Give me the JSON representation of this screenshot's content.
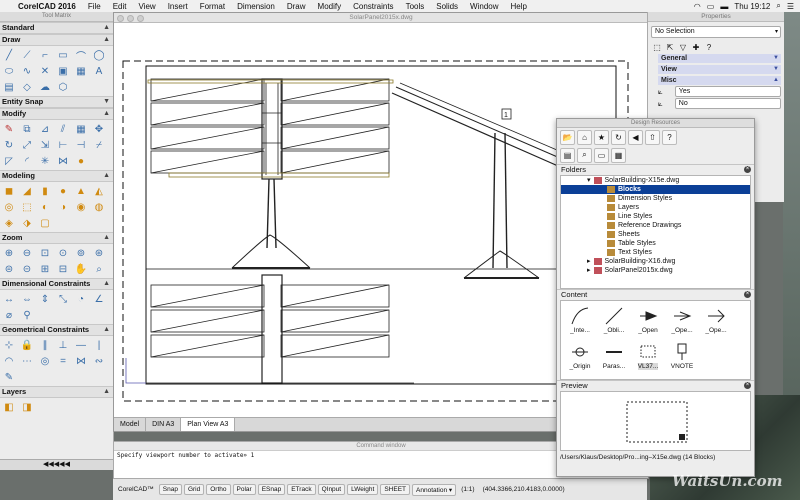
{
  "menubar": {
    "apple": "",
    "app_name": "CorelCAD 2016",
    "items": [
      "File",
      "Edit",
      "View",
      "Insert",
      "Format",
      "Dimension",
      "Draw",
      "Modify",
      "Constraints",
      "Tools",
      "Solids",
      "Window",
      "Help"
    ],
    "clock": "Thu 19:12"
  },
  "tool_matrix": {
    "title": "Tool Matrix",
    "sections": [
      "Standard",
      "Draw",
      "Entity Snap",
      "Modify",
      "Modeling",
      "Zoom",
      "Dimensional Constraints",
      "Geometrical Constraints",
      "Layers"
    ],
    "bottom_arrows": "◀◀◀◀◀"
  },
  "drawing": {
    "title": "SolarPanel2015x.dwg",
    "tabs": [
      "Model",
      "DIN A3",
      "Plan View A3"
    ]
  },
  "command_window": {
    "title": "Command window",
    "text": "Specify viewport number to activate» 1"
  },
  "status_bar": {
    "app": "CorelCAD™",
    "buttons": [
      "Snap",
      "Grid",
      "Ortho",
      "Polar",
      "ESnap",
      "ETrack",
      "QInput",
      "LWeight",
      "SHEET"
    ],
    "annotation": "Annotation",
    "scale": "(1:1)",
    "coords": "(404.3366,210.4183,0.0000)"
  },
  "properties": {
    "title": "Properties",
    "selection": "No Selection",
    "groups": [
      "General",
      "View",
      "Misc"
    ],
    "rows": [
      "Yes",
      "No"
    ]
  },
  "design_resources": {
    "title": "Design Resources",
    "folders_label": "Folders",
    "folders": [
      {
        "label": "SolarBuilding-X15e.dwg",
        "depth": 0,
        "expanded": true
      },
      {
        "label": "Blocks",
        "depth": 1,
        "selected": true
      },
      {
        "label": "Dimension Styles",
        "depth": 1
      },
      {
        "label": "Layers",
        "depth": 1
      },
      {
        "label": "Line Styles",
        "depth": 1
      },
      {
        "label": "Reference Drawings",
        "depth": 1
      },
      {
        "label": "Sheets",
        "depth": 1
      },
      {
        "label": "Table Styles",
        "depth": 1
      },
      {
        "label": "Text Styles",
        "depth": 1
      },
      {
        "label": "SolarBuilding-X16.dwg",
        "depth": 0
      },
      {
        "label": "SolarPanel2015x.dwg",
        "depth": 0
      }
    ],
    "content_label": "Content",
    "content": [
      {
        "label": "_Inte...",
        "icon": "curve-icon"
      },
      {
        "label": "_Obli...",
        "icon": "oblique-line-icon"
      },
      {
        "label": "_Open",
        "icon": "open-arrow-icon"
      },
      {
        "label": "_Ope...",
        "icon": "open-arrow-30-icon"
      },
      {
        "label": "_Ope...",
        "icon": "open-arrow-90-icon"
      },
      {
        "label": "_Origin",
        "icon": "origin-icon"
      },
      {
        "label": "Paras...",
        "icon": "parasol-icon"
      },
      {
        "label": "VL37...",
        "icon": "block-rect-icon",
        "selected": true
      },
      {
        "label": "VNOTE",
        "icon": "vnote-icon"
      }
    ],
    "preview_label": "Preview",
    "path": "/Users/Klaus/Desktop/Pro...ing–X15e.dwg (14 Blocks)"
  },
  "watermark": "WaitsUn.com"
}
